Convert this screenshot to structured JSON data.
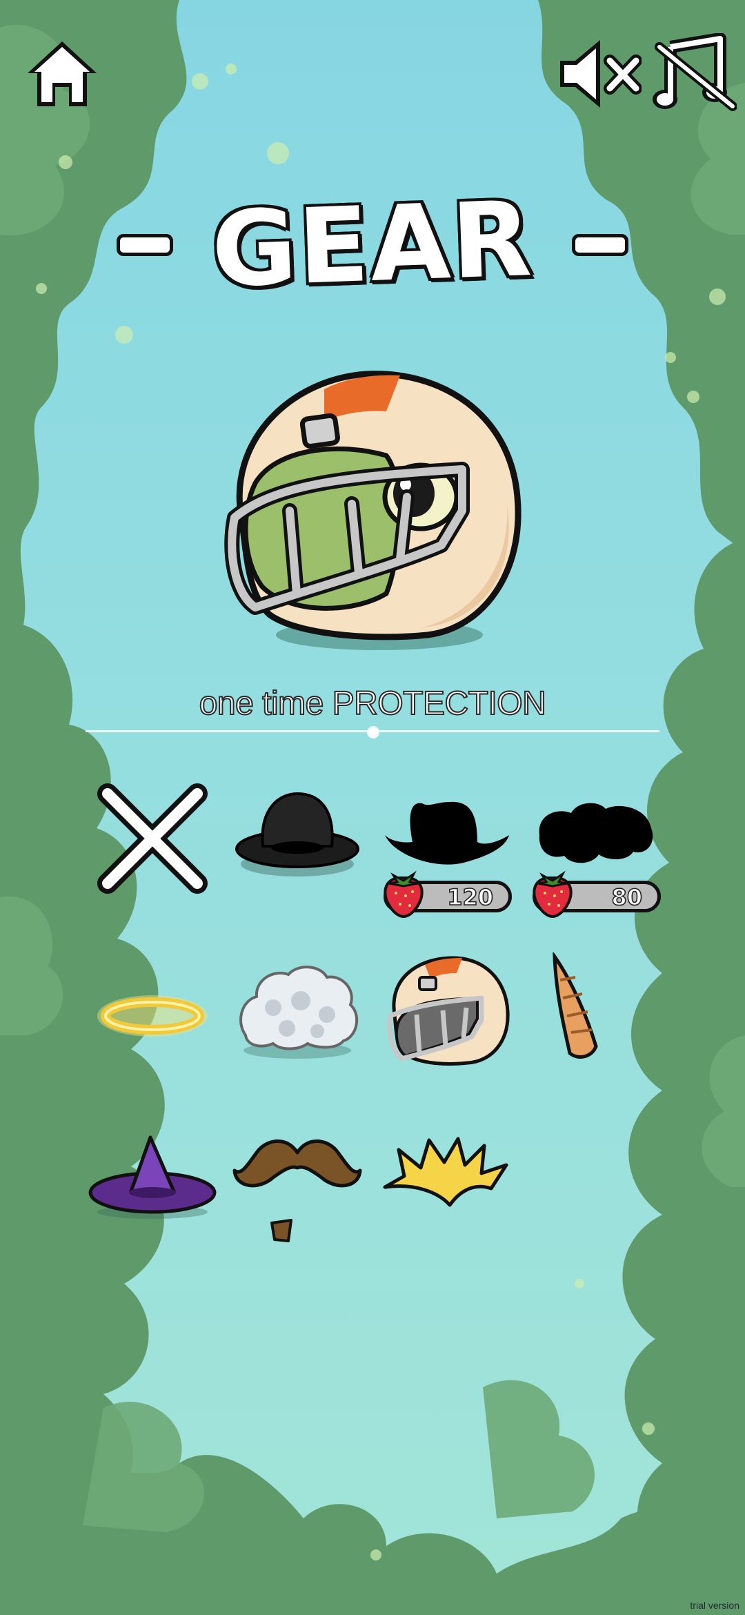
{
  "screen": {
    "title": "GEAR",
    "selected_item_description": "one time PROTECTION",
    "trial_label": "trial version"
  },
  "top_bar": {
    "home_icon": "home-icon",
    "sound_icon": "sound-muted-icon",
    "music_icon": "music-muted-icon"
  },
  "selected_item": {
    "icon": "football-helmet-icon"
  },
  "gear_items": [
    {
      "icon": "remove-gear-x-icon",
      "locked": false
    },
    {
      "icon": "bowler-hat-icon",
      "locked": false
    },
    {
      "icon": "cowboy-hat-icon",
      "locked": true,
      "price": "120",
      "currency_icon": "strawberry-icon"
    },
    {
      "icon": "wig-icon",
      "locked": true,
      "price": "80",
      "currency_icon": "strawberry-icon"
    },
    {
      "icon": "halo-icon",
      "locked": false
    },
    {
      "icon": "white-wig-icon",
      "locked": false
    },
    {
      "icon": "football-helmet-icon",
      "locked": false,
      "selected": true
    },
    {
      "icon": "horn-icon",
      "locked": false
    },
    {
      "icon": "wizard-hat-icon",
      "locked": false
    },
    {
      "icon": "mustache-icon",
      "locked": false
    },
    {
      "icon": "spiky-hair-icon",
      "locked": false
    }
  ],
  "colors": {
    "sky": "#86d6e2",
    "foliage": "#5f9a6b",
    "helmet_shell": "#f7e1c3",
    "helmet_stripe": "#e86b2a",
    "frog": "#9cbf6b"
  }
}
